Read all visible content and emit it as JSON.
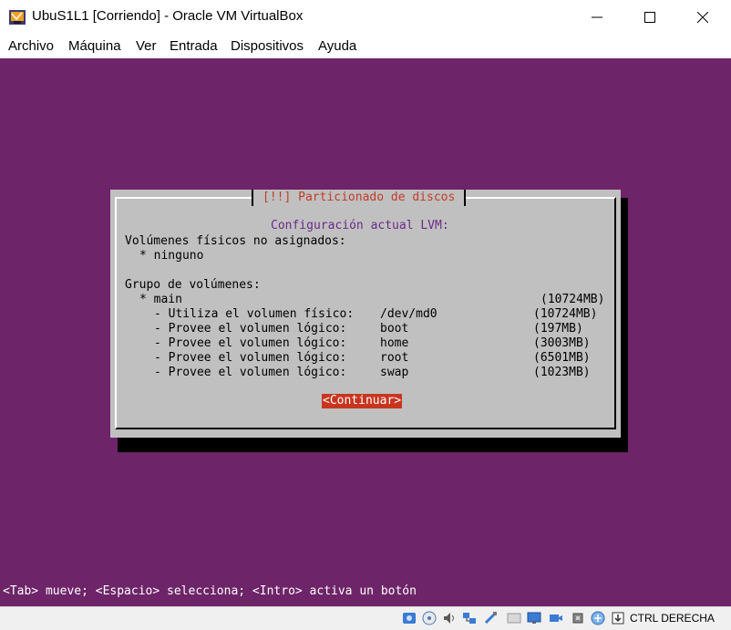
{
  "window": {
    "title": "UbuS1L1 [Corriendo] - Oracle VM VirtualBox"
  },
  "menu": [
    "Archivo",
    "Máquina",
    "Ver",
    "Entrada",
    "Dispositivos",
    "Ayuda"
  ],
  "dialog": {
    "title": "[!!] Particionado de discos",
    "heading": "Configuración actual LVM:",
    "unassigned_label": "Volúmenes físicos no asignados:",
    "unassigned_value": "* ninguno",
    "group_label": "Grupo de volúmenes:",
    "group_name": "* main",
    "group_size": "(10724MB)",
    "entries": [
      {
        "label": "- Utiliza el volumen físico:",
        "device": "/dev/md0",
        "size": "(10724MB)"
      },
      {
        "label": "- Provee el volumen lógico:",
        "device": "boot",
        "size": "(197MB)"
      },
      {
        "label": "- Provee el volumen lógico:",
        "device": "home",
        "size": "(3003MB)"
      },
      {
        "label": "- Provee el volumen lógico:",
        "device": "root",
        "size": "(6501MB)"
      },
      {
        "label": "- Provee el volumen lógico:",
        "device": "swap",
        "size": "(1023MB)"
      }
    ],
    "continue_label": "<Continuar>"
  },
  "help_line": "<Tab> mueve; <Espacio> selecciona; <Intro> activa un botón",
  "statusbar": {
    "host_key": "CTRL DERECHA",
    "icons": [
      "hard-disk-icon",
      "optical-drive-icon",
      "audio-icon",
      "network-icon",
      "usb-icon",
      "shared-folders-icon",
      "display-icon",
      "video-capture-icon",
      "cpu-icon",
      "guest-additions-icon",
      "keyboard-capture-icon"
    ]
  },
  "colors": {
    "vm_background": "#6e2468",
    "dialog_background": "#c0c0c0",
    "dialog_title": "#c13c2a",
    "button_active": "#c8351f"
  }
}
